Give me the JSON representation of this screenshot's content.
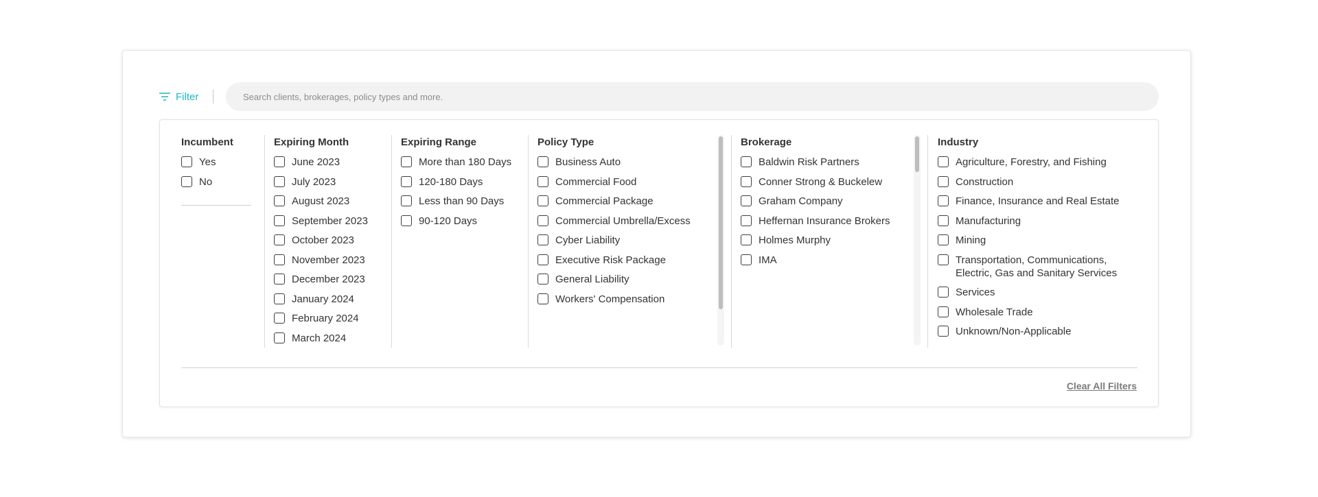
{
  "filter": {
    "label": "Filter",
    "icon": "filter-lines-icon",
    "accent": "#1fb5c2"
  },
  "search": {
    "placeholder": "Search clients, brokerages, policy types and more.",
    "value": ""
  },
  "incumbent": {
    "title": "Incumbent",
    "options": [
      "Yes",
      "No"
    ]
  },
  "expiring_month": {
    "title": "Expiring Month",
    "options": [
      "June 2023",
      "July 2023",
      "August 2023",
      "September 2023",
      "October 2023",
      "November 2023",
      "December 2023",
      "January 2024",
      "February 2024",
      "March 2024"
    ]
  },
  "expiring_range": {
    "title": "Expiring Range",
    "options": [
      "More than 180 Days",
      "120-180 Days",
      "Less than 90 Days",
      "90-120 Days"
    ]
  },
  "policy_type": {
    "title": "Policy Type",
    "options": [
      "Business Auto",
      "Commercial Food",
      "Commercial Package",
      "Commercial Umbrella/Excess",
      "Cyber Liability",
      "Executive Risk Package",
      "General Liability",
      "Workers' Compensation"
    ]
  },
  "brokerage": {
    "title": "Brokerage",
    "options": [
      "Baldwin Risk Partners",
      "Conner Strong & Buckelew",
      "Graham Company",
      "Heffernan Insurance Brokers",
      "Holmes Murphy",
      "IMA"
    ]
  },
  "industry": {
    "title": "Industry",
    "options": [
      "Agriculture, Forestry, and Fishing",
      "Construction",
      "Finance, Insurance and Real Estate",
      "Manufacturing",
      "Mining",
      "Transportation, Communications, Electric, Gas and Sanitary Services",
      "Services",
      "Wholesale Trade",
      "Unknown/Non-Applicable"
    ]
  },
  "footer": {
    "clear_label": "Clear All Filters"
  }
}
